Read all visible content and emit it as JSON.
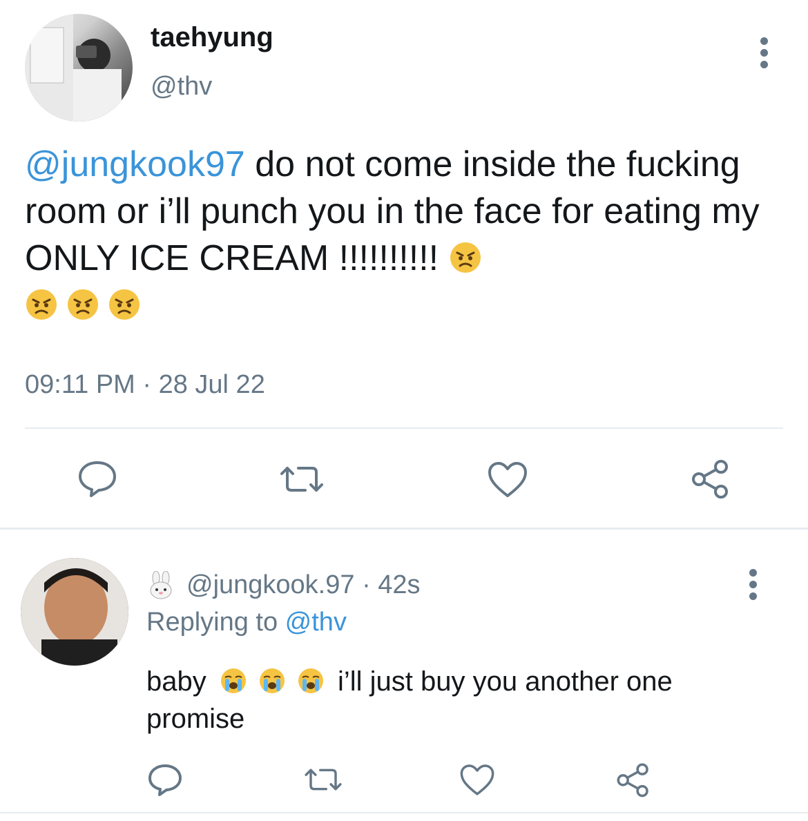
{
  "tweet": {
    "display_name": "taehyung",
    "handle": "@thv",
    "mention": "@jungkook97",
    "text_line": " do not come inside the fucking room or i’ll punch you in the face for eating my ONLY ICE CREAM !!!!!!!!!! ",
    "timestamp": "09:11 PM · 28 Jul 22"
  },
  "reply": {
    "handle": "@jungkook.97 · 42s",
    "replying_prefix": "Replying to ",
    "replying_handle": "@thv",
    "text_start": "baby",
    "text_end": "  i’ll just buy you another one promise"
  },
  "colors": {
    "mention": "#3b94d9",
    "secondary": "#657786",
    "divider": "#e6ecf0"
  },
  "icons": [
    "more-icon",
    "reply-icon",
    "retweet-icon",
    "like-icon",
    "share-icon",
    "angry-emoji-icon",
    "crying-emoji-icon",
    "rabbit-emoji-icon"
  ]
}
